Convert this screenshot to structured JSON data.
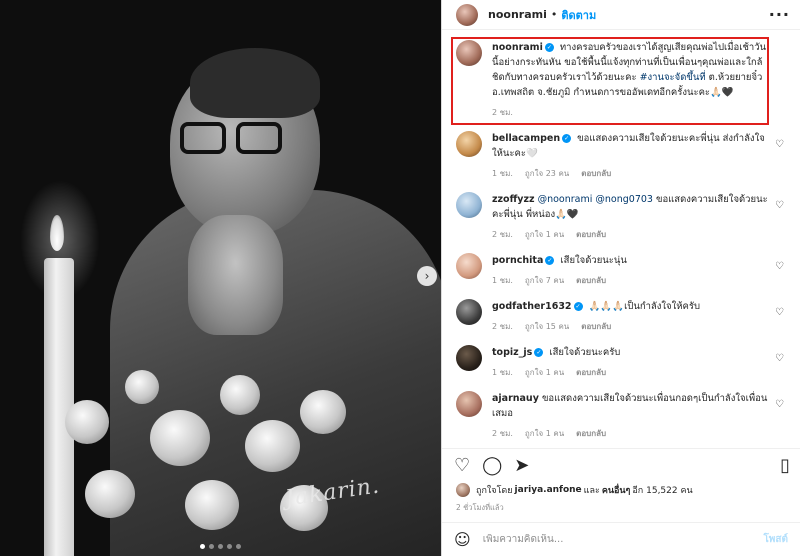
{
  "header": {
    "username": "noonrami",
    "separator": "•",
    "follow_label": "ติดตาม",
    "more_icon": "more-horizontal-icon"
  },
  "photo": {
    "signature_text": "Jakarin.",
    "carousel_dots": 5,
    "active_dot": 1
  },
  "caption": {
    "username": "noonrami",
    "text_before_tag": "ทางครอบครัวของเราได้สูญเสียคุณพ่อไปเมื่อเช้าวันนี้อย่างกระทันหัน ขอใช้พื้นนี้แจ้งทุกท่านที่เป็นเพื่อนๆคุณพ่อและใกล้ชิดกับทางครอบครัวเราไว้ด้วยนะคะ ",
    "hashtag": "#งานจะจัดขึ้นที่",
    "text_after_tag": " ต.ห้วยยายจิ๋ว อ.เทพสถิต จ.ชัยภูมิ กำหนดการขออัพเดทอีกครั้งนะคะ🙏🏻🖤",
    "time": "2 ชม."
  },
  "comments": [
    {
      "username": "bellacampen",
      "verified": true,
      "text": "ขอแสดงความเสียใจด้วยนะคะพี่นุ่น ส่งกำลังใจให้นะคะ🤍",
      "time": "1 ชม.",
      "likes": "ถูกใจ 23 คน",
      "reply": "ตอบกลับ"
    },
    {
      "username": "zzoffyzz",
      "verified": false,
      "mentions": "@noonrami @nong0703",
      "text": " ขอแสดงความเสียใจด้วยนะคะพี่นุ่น พี่หน่อง🙏🏻🖤",
      "time": "2 ชม.",
      "likes": "ถูกใจ 1 คน",
      "reply": "ตอบกลับ"
    },
    {
      "username": "pornchita",
      "verified": true,
      "text": "เสียใจด้วยนะนุ่น",
      "time": "1 ชม.",
      "likes": "ถูกใจ 7 คน",
      "reply": "ตอบกลับ"
    },
    {
      "username": "godfather1632",
      "verified": true,
      "text": "🙏🏻🙏🏻🙏🏻เป็นกำลังใจให้ครับ",
      "time": "2 ชม.",
      "likes": "ถูกใจ 15 คน",
      "reply": "ตอบกลับ"
    },
    {
      "username": "topiz_js",
      "verified": true,
      "text": "เสียใจด้วยนะครับ",
      "time": "1 ชม.",
      "likes": "ถูกใจ 1 คน",
      "reply": "ตอบกลับ"
    },
    {
      "username": "ajarnauy",
      "verified": false,
      "text": "ขอแสดงความเสียใจด้วยนะเพื่อนกอดๆเป็นกำลังใจเพื่อนเสมอ",
      "time": "2 ชม.",
      "likes": "ถูกใจ 1 คน",
      "reply": "ตอบกลับ"
    }
  ],
  "actions": {
    "like_icon": "heart-icon",
    "comment_icon": "comment-icon",
    "share_icon": "send-icon",
    "save_icon": "bookmark-icon"
  },
  "likes_summary": {
    "prefix": "ถูกใจโดย",
    "first_user": "jariya.anfone",
    "middle": "และ",
    "others_label": "คนอื่นๆ",
    "count_text": "อีก 15,522 คน"
  },
  "posted_time": "2 ชั่วโมงที่แล้ว",
  "composer": {
    "placeholder": "เพิ่มความคิดเห็น...",
    "post_label": "โพสต์",
    "emoji_icon": "emoji-icon"
  }
}
